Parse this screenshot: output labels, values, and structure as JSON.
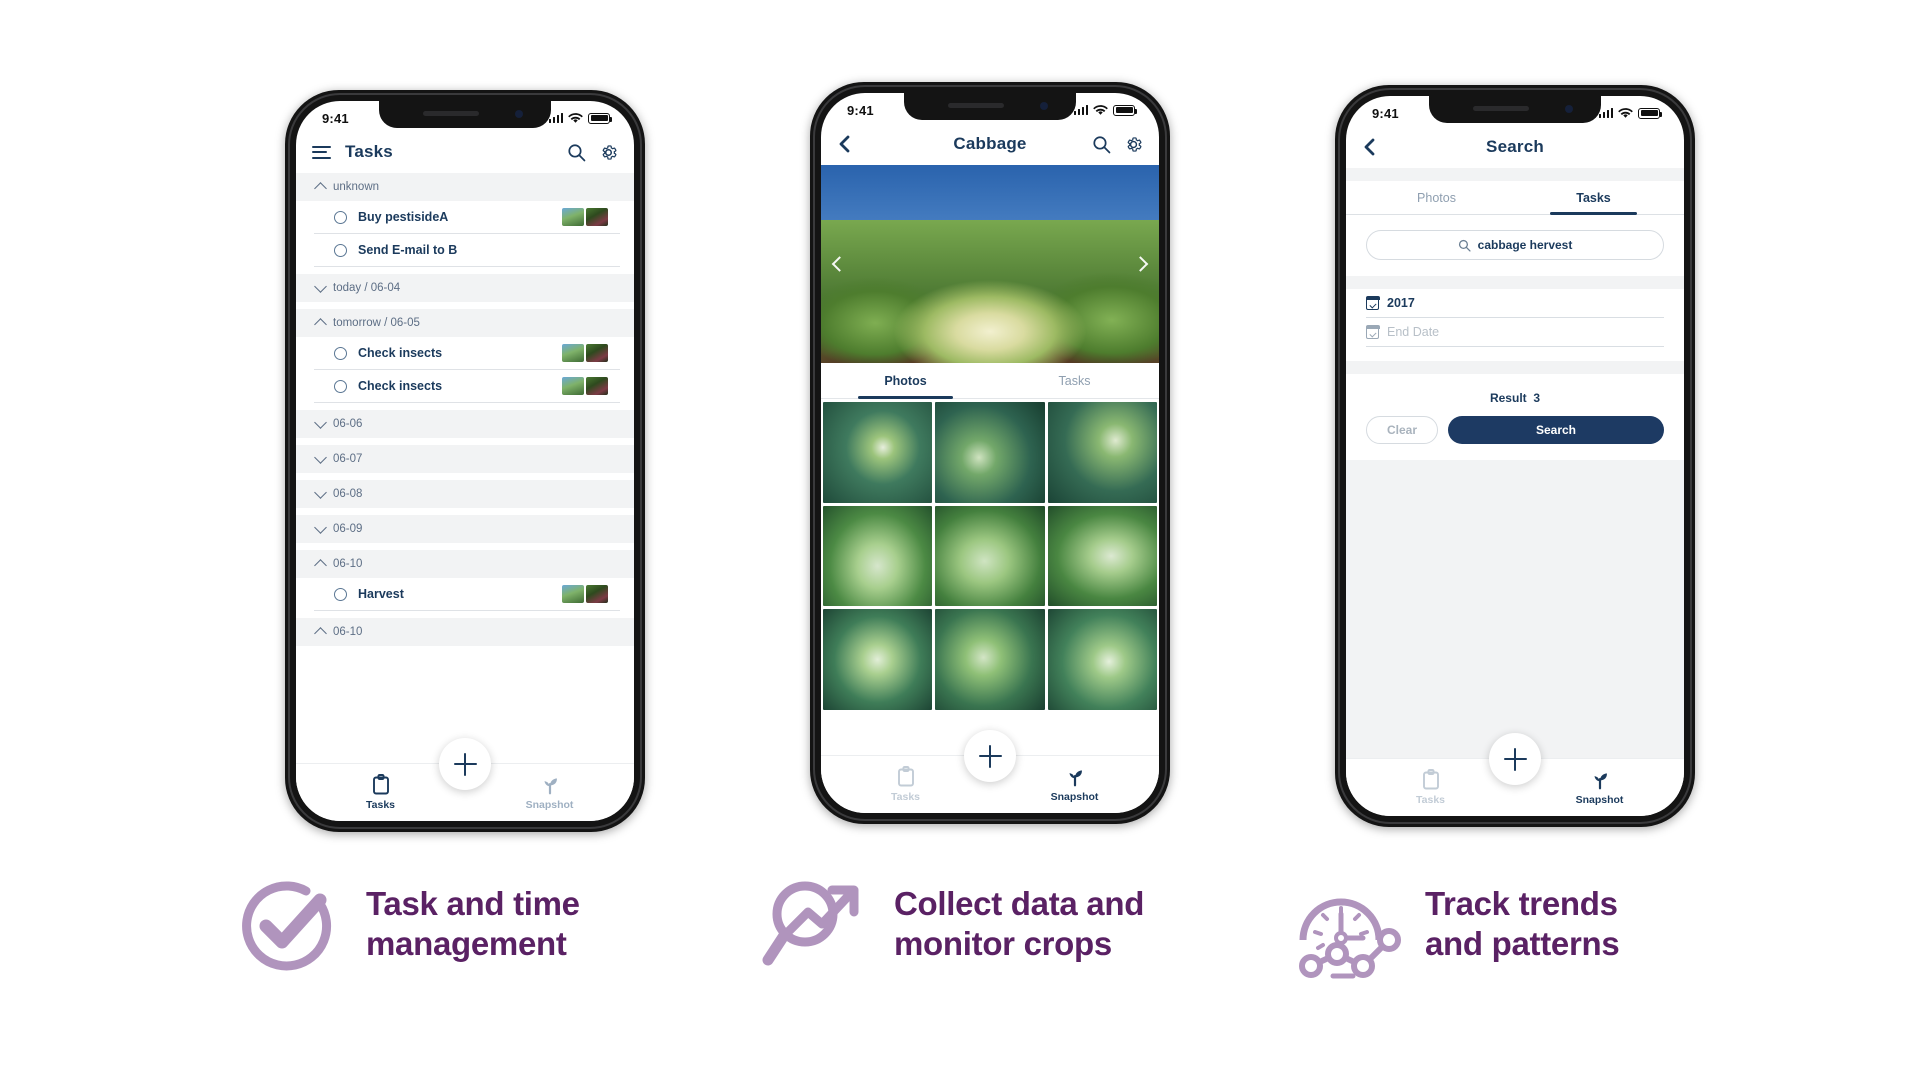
{
  "colors": {
    "brand_navy": "#1b3a5c",
    "btn_navy": "#1d3a63",
    "caption_purple": "#5a2164",
    "icon_purple": "#b094bd",
    "muted": "#8f9fb0",
    "band": "#f2f3f4"
  },
  "phone1": {
    "status": {
      "time": "9:41"
    },
    "nav": {
      "menu_icon": "hamburger-icon",
      "title": "Tasks",
      "search_icon": "search-icon",
      "settings_icon": "gear-icon"
    },
    "groups": [
      {
        "label": "unknown",
        "state": "expanded",
        "chevron": "chevron-up-icon",
        "tasks": [
          {
            "label": "Buy pestisideA",
            "checked": false,
            "thumbs": 2
          },
          {
            "label": "Send E-mail to B",
            "checked": false,
            "thumbs": 0
          }
        ]
      },
      {
        "label": "today / 06-04",
        "state": "collapsed",
        "chevron": "chevron-down-icon",
        "tasks": []
      },
      {
        "label": "tomorrow / 06-05",
        "state": "expanded",
        "chevron": "chevron-up-icon",
        "tasks": [
          {
            "label": "Check insects",
            "checked": false,
            "thumbs": 2
          },
          {
            "label": "Check insects",
            "checked": false,
            "thumbs": 2
          }
        ]
      },
      {
        "label": "06-06",
        "state": "collapsed",
        "chevron": "chevron-down-icon",
        "tasks": []
      },
      {
        "label": "06-07",
        "state": "collapsed",
        "chevron": "chevron-down-icon",
        "tasks": []
      },
      {
        "label": "06-08",
        "state": "collapsed",
        "chevron": "chevron-down-icon",
        "tasks": []
      },
      {
        "label": "06-09",
        "state": "collapsed",
        "chevron": "chevron-down-icon",
        "tasks": []
      },
      {
        "label": "06-10",
        "state": "expanded",
        "chevron": "chevron-up-icon",
        "tasks": [
          {
            "label": "Harvest",
            "checked": false,
            "thumbs": 2
          }
        ]
      },
      {
        "label": "06-10",
        "state": "expanded",
        "chevron": "chevron-up-icon",
        "tasks": []
      }
    ],
    "fab": {
      "icon": "plus-icon"
    },
    "tabbar": {
      "tasks": {
        "label": "Tasks",
        "icon": "clipboard-icon",
        "active": true
      },
      "snapshot": {
        "label": "Snapshot",
        "icon": "sprout-icon",
        "active": false
      }
    }
  },
  "phone2": {
    "status": {
      "time": "9:41"
    },
    "nav": {
      "back_icon": "chevron-left-icon",
      "title": "Cabbage",
      "search_icon": "search-icon",
      "settings_icon": "gear-icon"
    },
    "hero": {
      "prev_icon": "chevron-left-icon",
      "next_icon": "chevron-right-icon"
    },
    "tabs": [
      {
        "label": "Photos",
        "active": true
      },
      {
        "label": "Tasks",
        "active": false
      }
    ],
    "photo_count": 9,
    "fab": {
      "icon": "plus-icon"
    },
    "tabbar": {
      "tasks": {
        "label": "Tasks",
        "icon": "clipboard-icon",
        "active": false
      },
      "snapshot": {
        "label": "Snapshot",
        "icon": "sprout-icon",
        "active": true
      }
    }
  },
  "phone3": {
    "status": {
      "time": "9:41"
    },
    "nav": {
      "back_icon": "chevron-left-icon",
      "title": "Search"
    },
    "tabs": [
      {
        "label": "Photos",
        "active": false
      },
      {
        "label": "Tasks",
        "active": true
      }
    ],
    "search_field": {
      "icon": "search-icon",
      "value": "cabbage hervest"
    },
    "start_date": {
      "icon": "calendar-icon",
      "value": "2017"
    },
    "end_date": {
      "icon": "calendar-icon",
      "placeholder": "End Date"
    },
    "result": {
      "label": "Result",
      "count": "3"
    },
    "buttons": {
      "clear": "Clear",
      "search": "Search"
    },
    "fab": {
      "icon": "plus-icon"
    },
    "tabbar": {
      "tasks": {
        "label": "Tasks",
        "icon": "clipboard-icon",
        "active": false
      },
      "snapshot": {
        "label": "Snapshot",
        "icon": "sprout-icon",
        "active": true
      }
    }
  },
  "captions": [
    {
      "icon": "check-circle-icon",
      "line1": "Task and time",
      "line2": "management"
    },
    {
      "icon": "trend-arrow-magnifier-icon",
      "line1": "Collect data and",
      "line2": "monitor crops"
    },
    {
      "icon": "clock-chart-icon",
      "line1": "Track trends",
      "line2": "and patterns"
    }
  ]
}
